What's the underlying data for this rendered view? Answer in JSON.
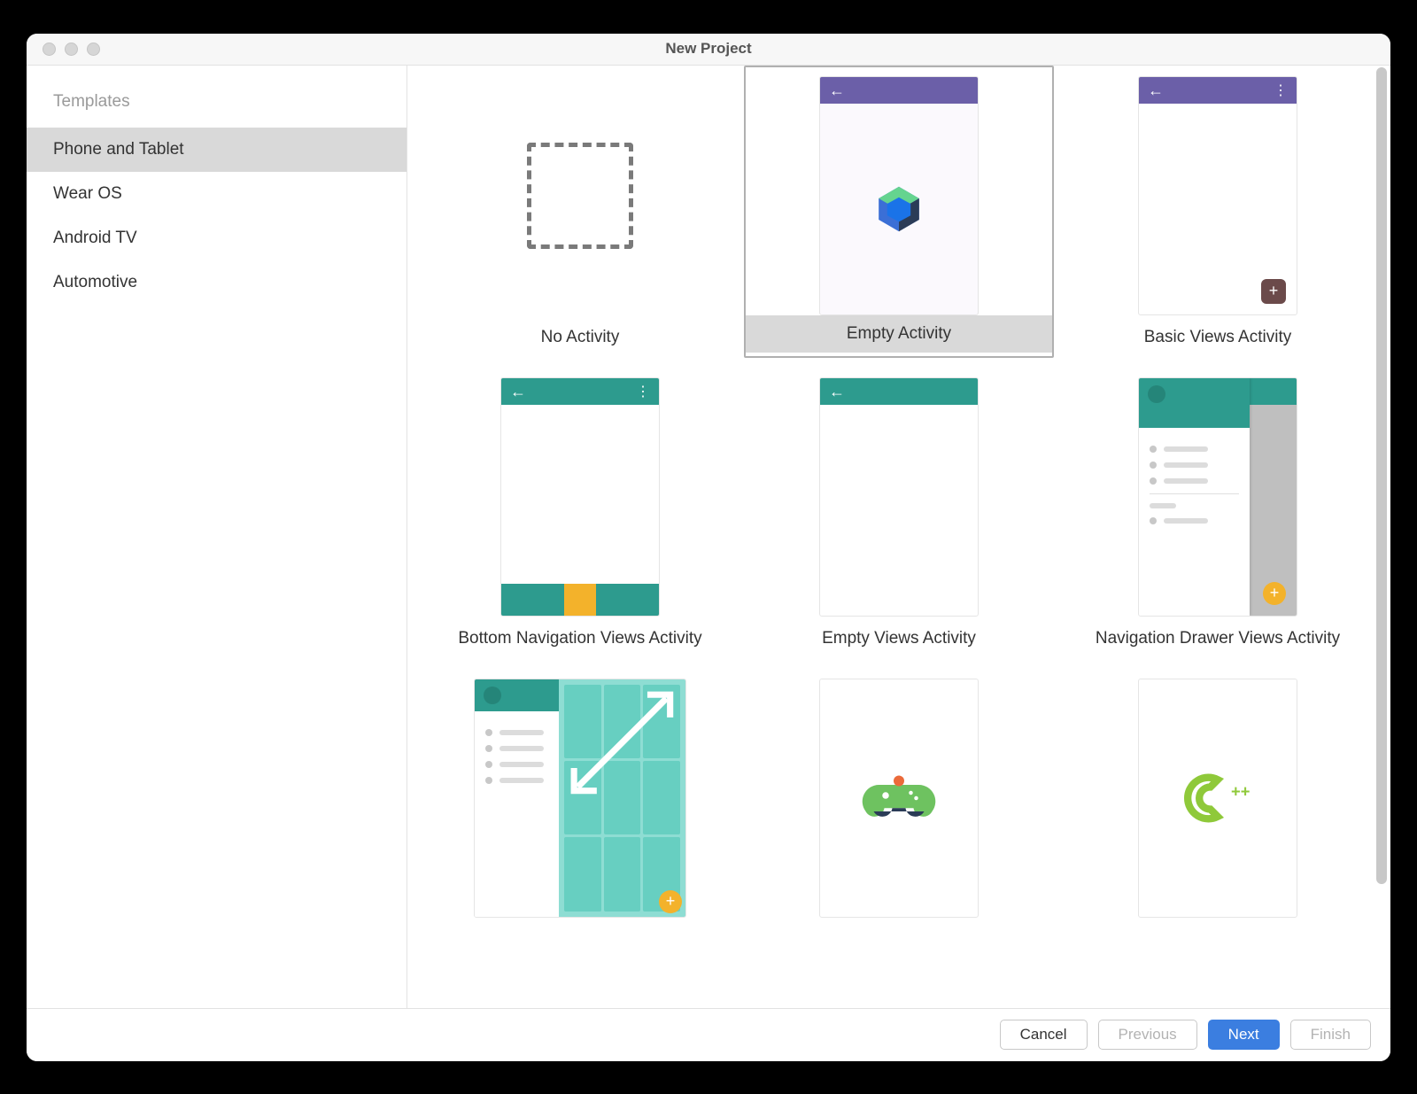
{
  "window": {
    "title": "New Project"
  },
  "sidebar": {
    "header": "Templates",
    "items": [
      {
        "label": "Phone and Tablet",
        "selected": true
      },
      {
        "label": "Wear OS",
        "selected": false
      },
      {
        "label": "Android TV",
        "selected": false
      },
      {
        "label": "Automotive",
        "selected": false
      }
    ]
  },
  "templates": [
    {
      "id": "no-activity",
      "label": "No Activity",
      "selected": false
    },
    {
      "id": "empty-activity",
      "label": "Empty Activity",
      "selected": true
    },
    {
      "id": "basic-views-activity",
      "label": "Basic Views Activity",
      "selected": false
    },
    {
      "id": "bottom-navigation-views-activity",
      "label": "Bottom Navigation Views Activity",
      "selected": false
    },
    {
      "id": "empty-views-activity",
      "label": "Empty Views Activity",
      "selected": false
    },
    {
      "id": "navigation-drawer-views-activity",
      "label": "Navigation Drawer Views Activity",
      "selected": false
    },
    {
      "id": "responsive-views-activity",
      "label": "",
      "selected": false
    },
    {
      "id": "game-activity",
      "label": "",
      "selected": false
    },
    {
      "id": "native-cpp",
      "label": "",
      "selected": false
    }
  ],
  "footer": {
    "cancel": "Cancel",
    "previous": "Previous",
    "next": "Next",
    "finish": "Finish"
  },
  "colors": {
    "purple": "#6B5FA8",
    "teal": "#2D9B8E",
    "amber": "#f3b22b",
    "primaryBtn": "#3B7EE0"
  }
}
